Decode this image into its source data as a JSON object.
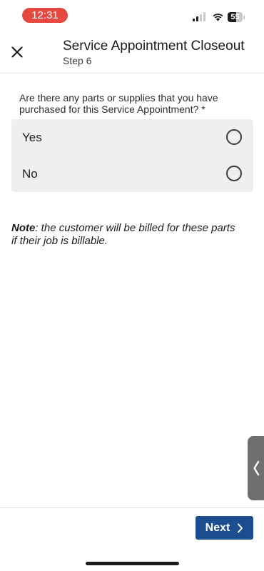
{
  "status_bar": {
    "time": "12:31",
    "battery_level": "55",
    "battery_fraction": 0.55,
    "time_pill_color": "#e5483f"
  },
  "header": {
    "title": "Service Appointment Closeout",
    "step": "Step 6",
    "close_icon": "close-icon"
  },
  "question": {
    "text": "Are there any parts or supplies that you have purchased for this Service Appointment? *",
    "options": [
      {
        "label": "Yes",
        "selected": false
      },
      {
        "label": "No",
        "selected": false
      }
    ]
  },
  "note": {
    "label": "Note",
    "text": ": the customer will be billed for these parts if their job is billable."
  },
  "drawer_handle": {
    "icon": "chevron-left-icon"
  },
  "footer": {
    "next_label": "Next",
    "next_icon": "chevron-right-icon",
    "accent_color": "#1b4d8f"
  }
}
